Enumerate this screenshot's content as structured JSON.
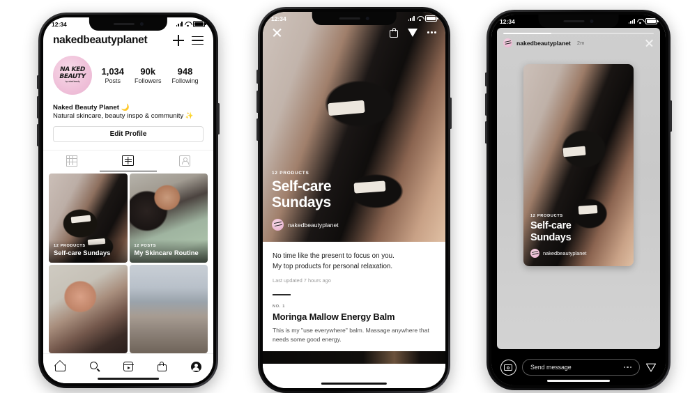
{
  "status_bar": {
    "time": "12:34"
  },
  "profile_phone": {
    "username": "nakedbeautyplanet",
    "icons": {
      "add": "plus-icon",
      "menu": "hamburger-menu-icon"
    },
    "avatar_logo": {
      "line1": "NA KED",
      "line2": "BEAUTY",
      "tagline": "by naked beauty"
    },
    "stats": [
      {
        "value": "1,034",
        "label": "Posts"
      },
      {
        "value": "90k",
        "label": "Followers"
      },
      {
        "value": "948",
        "label": "Following"
      }
    ],
    "bio": {
      "name": "Naked Beauty Planet 🌙",
      "text": "Natural skincare, beauty inspo & community ✨"
    },
    "edit_profile_label": "Edit Profile",
    "tabs": [
      {
        "name": "grid-tab",
        "icon": "grid-icon",
        "active": false
      },
      {
        "name": "guides-tab",
        "icon": "guides-book-icon",
        "active": true
      },
      {
        "name": "tagged-tab",
        "icon": "tagged-person-icon",
        "active": false
      }
    ],
    "guide_cards": [
      {
        "kicker": "12 PRODUCTS",
        "title": "Self-care Sundays",
        "photo": "ph-jars"
      },
      {
        "kicker": "12 POSTS",
        "title": "My Skincare Routine",
        "photo": "ph-green"
      },
      {
        "kicker": "",
        "title": "",
        "photo": "ph-makeup"
      },
      {
        "kicker": "",
        "title": "",
        "photo": "ph-city"
      }
    ],
    "nav": [
      {
        "name": "nav-home",
        "icon": "home-icon"
      },
      {
        "name": "nav-search",
        "icon": "search-icon"
      },
      {
        "name": "nav-reels",
        "icon": "reels-icon"
      },
      {
        "name": "nav-shop",
        "icon": "shopping-bag-icon"
      },
      {
        "name": "nav-profile",
        "icon": "profile-avatar-icon"
      }
    ]
  },
  "guide_phone": {
    "topbar": {
      "close": "close-x-icon",
      "bag": "shopping-bag-icon",
      "share": "send-paper-plane-icon",
      "more": "more-options-icon"
    },
    "hero": {
      "kicker": "12 PRODUCTS",
      "title_line1": "Self-care",
      "title_line2": "Sundays",
      "author": "nakedbeautyplanet"
    },
    "body": {
      "intro_line1": "No time like the present to focus on you.",
      "intro_line2": "My top products for personal relaxation.",
      "updated": "Last updated 7 hours ago",
      "product_number": "NO. 1",
      "product_title": "Moringa Mallow Energy Balm",
      "product_desc": "This is my \"use everywhere\" balm. Massage anywhere that needs some good energy."
    }
  },
  "story_phone": {
    "header": {
      "username": "nakedbeautyplanet",
      "time": "2m",
      "close": "close-x-icon",
      "progress_percent": 32
    },
    "card": {
      "kicker": "12 PRODUCTS",
      "title_line1": "Self-care",
      "title_line2": "Sundays",
      "author": "nakedbeautyplanet"
    },
    "footer": {
      "camera": "camera-icon",
      "input_placeholder": "Send message",
      "more": "more-options-icon",
      "send": "send-paper-plane-icon"
    }
  },
  "colors": {
    "brand_pink": "#eebdd6",
    "accent_dark": "#111111",
    "story_bg": "#cfcfcf"
  }
}
